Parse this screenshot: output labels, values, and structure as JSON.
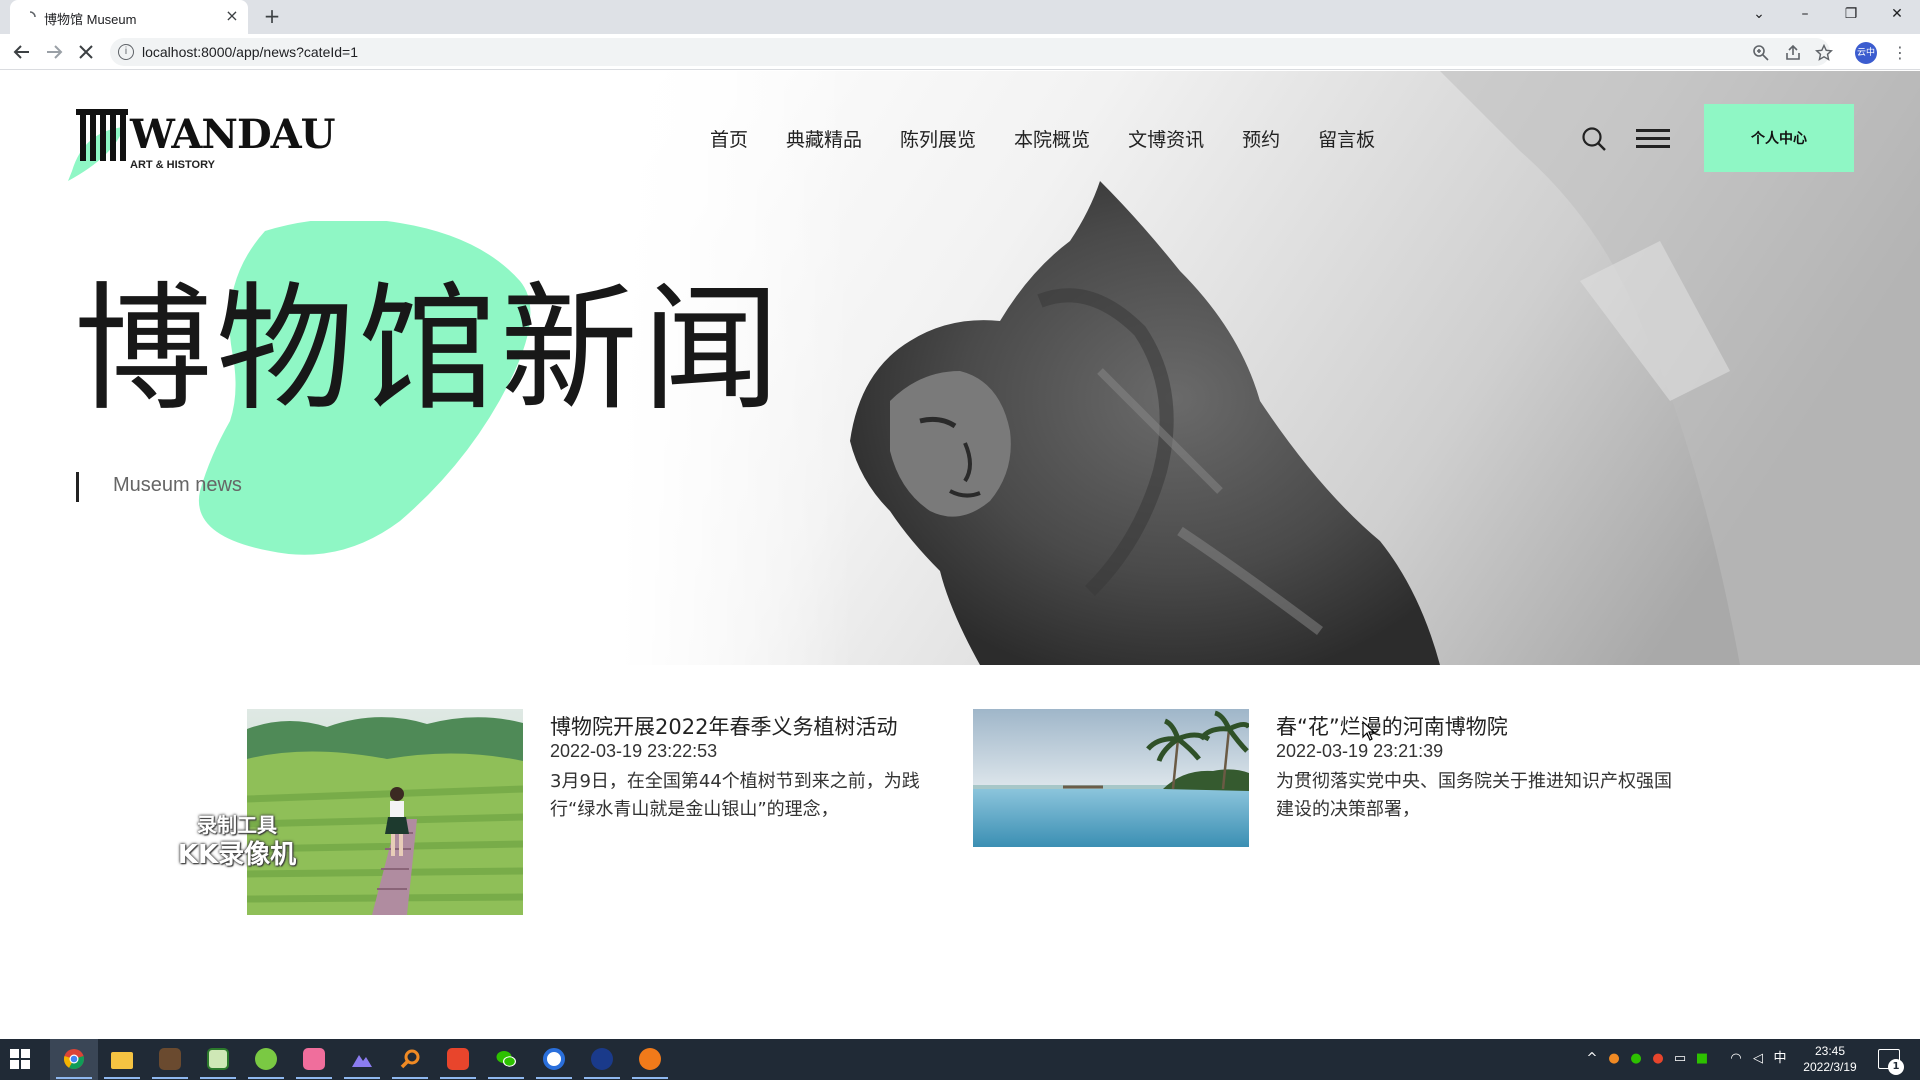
{
  "browser": {
    "tab_title": "博物馆 Museum",
    "tab_close": "×",
    "new_tab": "+",
    "url": "localhost:8000/app/news?cateId=1",
    "profile_label": "云中",
    "window_controls": {
      "minimize": "–",
      "restore": "❐",
      "close": "✕",
      "tab_search": "⌄"
    },
    "icons": {
      "back": "arrow-left",
      "forward": "arrow-right",
      "loading": "close-x",
      "site_info": "info",
      "zoom": "magnifier",
      "share": "share",
      "bookmark": "star"
    }
  },
  "header": {
    "logo_word": "WANDAU",
    "logo_sub": "ART & HISTORY",
    "nav": [
      "首页",
      "典藏精品",
      "陈列展览",
      "本院概览",
      "文博资讯",
      "预约",
      "留言板"
    ],
    "user_center": "个人中心",
    "accent_color": "#8ff7c5"
  },
  "hero": {
    "title": "博物馆新闻",
    "subtitle": "Museum news"
  },
  "news": [
    {
      "title": "博物院开展2022年春季义务植树活动",
      "date": "2022-03-19 23:22:53",
      "summary": "3月9日，在全国第44个植树节到来之前，为践行“绿水青山就是金山银山”的理念，",
      "thumb": "girl-on-tea-field-path"
    },
    {
      "title": "春“花”烂漫的河南博物院",
      "date": "2022-03-19 23:21:39",
      "summary": "为贯彻落实党中央、国务院关于推进知识产权强国建设的决策部署，",
      "thumb": "infinity-pool-palm-trees"
    }
  ],
  "watermark": {
    "line1": "录制工具",
    "line2": "KK录像机"
  },
  "taskbar": {
    "time": "23:45",
    "date": "2022/3/19",
    "ime": "中",
    "notifications": "1"
  }
}
